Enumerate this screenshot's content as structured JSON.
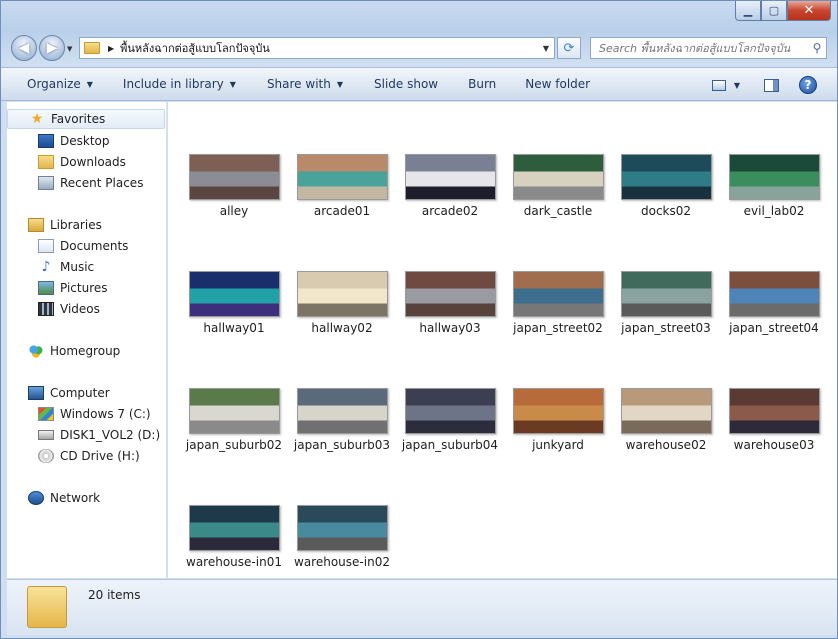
{
  "window": {
    "controls": {
      "minimize": "▁",
      "maximize": "▢",
      "close": "✕"
    }
  },
  "address": {
    "path": "พื้นหลังฉากต่อสู้แบบโลกปัจจุบัน",
    "placeholder": "Search พื้นหลังฉากต่อสู้แบบโลกปัจจุบัน"
  },
  "toolbar": {
    "organize": "Organize",
    "include": "Include in library",
    "share": "Share with",
    "slideshow": "Slide show",
    "burn": "Burn",
    "new_folder": "New folder"
  },
  "nav": {
    "favorites": "Favorites",
    "desktop": "Desktop",
    "downloads": "Downloads",
    "recent": "Recent Places",
    "libraries": "Libraries",
    "documents": "Documents",
    "music": "Music",
    "pictures": "Pictures",
    "videos": "Videos",
    "homegroup": "Homegroup",
    "computer": "Computer",
    "drive_c": "Windows 7 (C:)",
    "drive_d": "DISK1_VOL2 (D:)",
    "drive_h": "CD Drive (H:)",
    "network": "Network"
  },
  "files": [
    {
      "name": "alley",
      "colors": [
        "#7d5f55",
        "#8c8c94",
        "#5a4540"
      ]
    },
    {
      "name": "arcade01",
      "colors": [
        "#b88a6a",
        "#4aa39a",
        "#c2b7a3"
      ]
    },
    {
      "name": "arcade02",
      "colors": [
        "#7a7f93",
        "#e6e6ea",
        "#1d1d2b"
      ]
    },
    {
      "name": "dark_castle",
      "colors": [
        "#2e5d3d",
        "#d7d1bf",
        "#8a8a8a"
      ]
    },
    {
      "name": "docks02",
      "colors": [
        "#1e4b5a",
        "#2f7c86",
        "#17323e"
      ]
    },
    {
      "name": "evil_lab02",
      "colors": [
        "#1b4a3a",
        "#3b8d5d",
        "#87a39a"
      ]
    },
    {
      "name": "hallway01",
      "colors": [
        "#1a2e6b",
        "#22a0a8",
        "#3d2f7c"
      ]
    },
    {
      "name": "hallway02",
      "colors": [
        "#d9cbb0",
        "#f1e6c9",
        "#7c7565"
      ]
    },
    {
      "name": "hallway03",
      "colors": [
        "#6e4a40",
        "#9a9aa2",
        "#58423c"
      ]
    },
    {
      "name": "japan_street02",
      "colors": [
        "#a06e4e",
        "#3e6e8e",
        "#777"
      ]
    },
    {
      "name": "japan_street03",
      "colors": [
        "#3f6a5c",
        "#8aa2a0",
        "#5a5a5a"
      ]
    },
    {
      "name": "japan_street04",
      "colors": [
        "#7c4e3e",
        "#4f84b8",
        "#6b6b6b"
      ]
    },
    {
      "name": "japan_suburb02",
      "colors": [
        "#5a7a4a",
        "#d8d8d0",
        "#8a8a8a"
      ]
    },
    {
      "name": "japan_suburb03",
      "colors": [
        "#5a6a7a",
        "#d7d4ca",
        "#707070"
      ]
    },
    {
      "name": "japan_suburb04",
      "colors": [
        "#3c3e52",
        "#6e7488",
        "#2b2d3c"
      ]
    },
    {
      "name": "junkyard",
      "colors": [
        "#b86b3a",
        "#c98a4a",
        "#6a3a22"
      ]
    },
    {
      "name": "warehouse02",
      "colors": [
        "#b89a7a",
        "#e2d6c4",
        "#7a6a5a"
      ]
    },
    {
      "name": "warehouse03",
      "colors": [
        "#5a3a32",
        "#8a5a4a",
        "#2e2a3a"
      ]
    },
    {
      "name": "warehouse-in01",
      "colors": [
        "#1e3a4a",
        "#3a8a8a",
        "#2a2a3a"
      ]
    },
    {
      "name": "warehouse-in02",
      "colors": [
        "#2a4a5a",
        "#4a8aa0",
        "#5a5a5a"
      ]
    }
  ],
  "details": {
    "count": "20 items"
  }
}
